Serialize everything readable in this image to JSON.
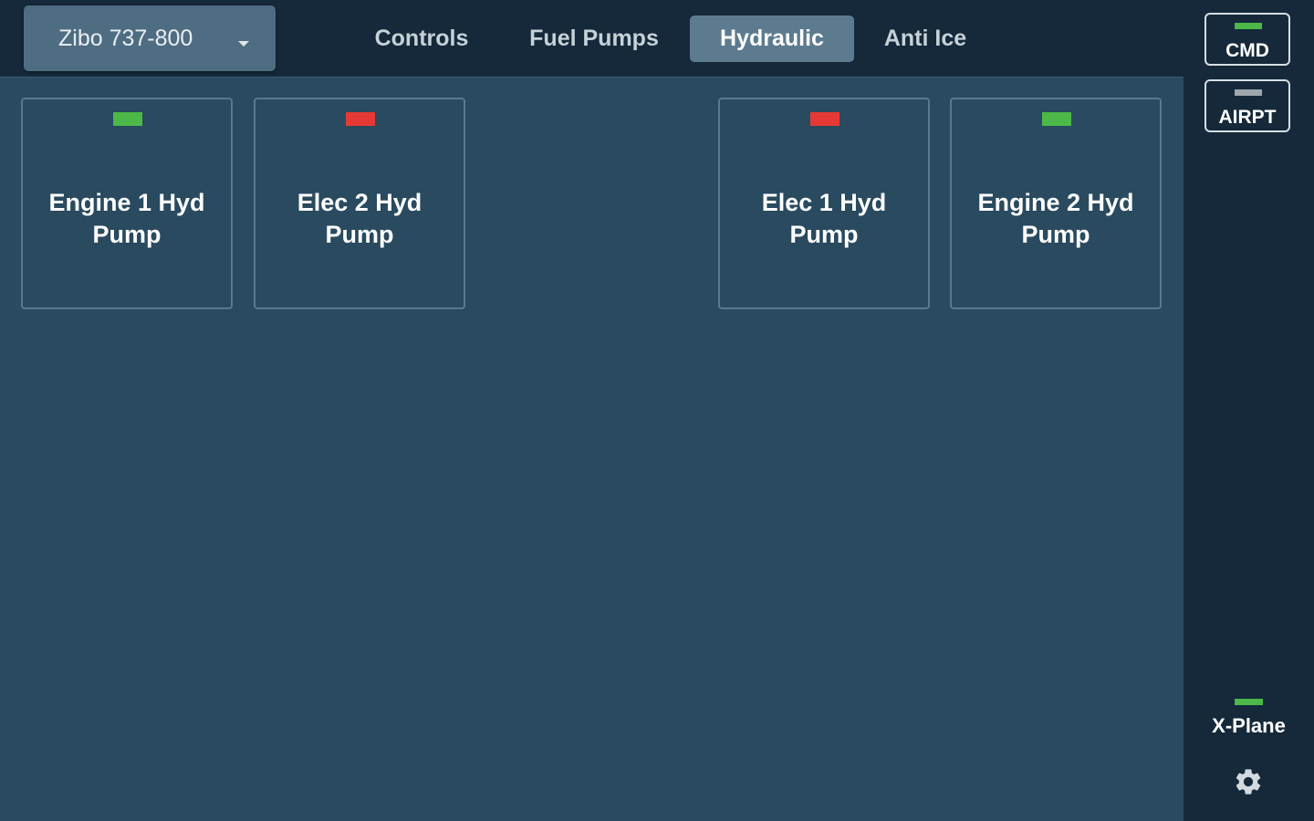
{
  "profile": {
    "label": "Zibo 737-800"
  },
  "tabs": [
    {
      "label": "Controls",
      "active": false
    },
    {
      "label": "Fuel Pumps",
      "active": false
    },
    {
      "label": "Hydraulic",
      "active": true
    },
    {
      "label": "Anti Ice",
      "active": false
    }
  ],
  "tiles": [
    {
      "label": "Engine 1 Hyd Pump",
      "status": "on",
      "indicator_color": "#4cb848"
    },
    {
      "label": "Elec 2 Hyd Pump",
      "status": "off",
      "indicator_color": "#e53935"
    },
    {
      "label": "Elec 1 Hyd Pump",
      "status": "off",
      "indicator_color": "#e53935"
    },
    {
      "label": "Engine 2 Hyd Pump",
      "status": "on",
      "indicator_color": "#4cb848"
    }
  ],
  "sidebar": {
    "buttons": [
      {
        "label": "CMD",
        "status": "on",
        "indicator_color": "#4cb848"
      },
      {
        "label": "AIRPT",
        "status": "inactive",
        "indicator_color": "#9ea7ad"
      }
    ],
    "connection": {
      "label": "X-Plane",
      "status": "connected",
      "indicator_color": "#4cb848"
    },
    "settings_icon": "gear-icon"
  },
  "colors": {
    "background": "#294a5f",
    "topbar": "#15293a",
    "active_tab": "#5c7b8f",
    "indicator_on": "#4cb848",
    "indicator_off": "#e53935"
  }
}
